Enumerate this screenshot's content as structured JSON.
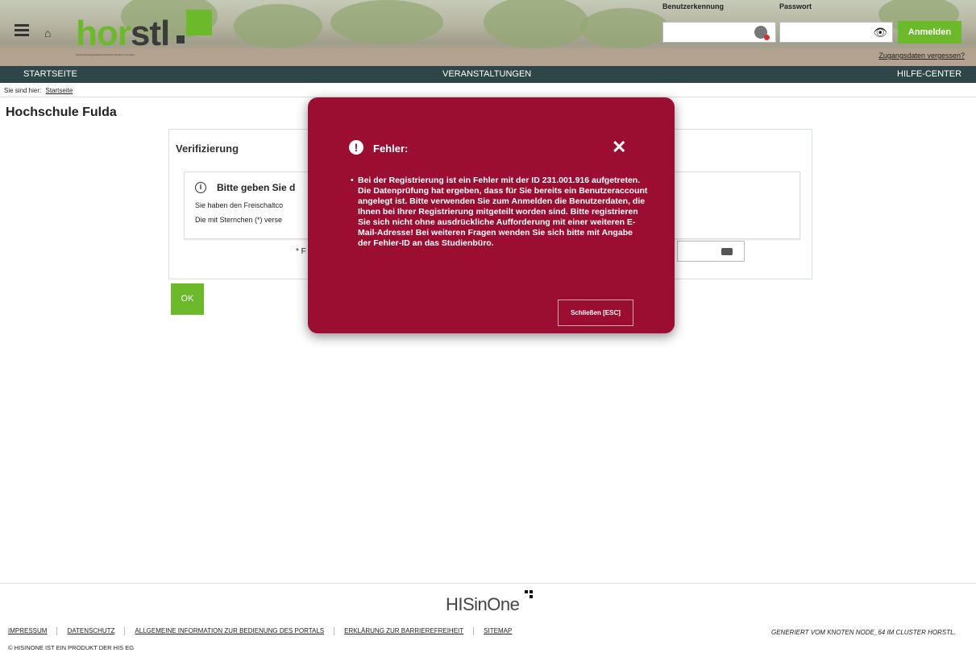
{
  "header": {
    "logo_text_green": "hor",
    "logo_text_dark": "stl",
    "logo_subtitle": "Hochschul-Organisations-Portal für Studium und Lehre",
    "username_label": "Benutzerkennung",
    "password_label": "Passwort",
    "username_value": "",
    "password_value": "",
    "login_button": "Anmelden",
    "forgot_link": "Zugangsdaten vergessen?"
  },
  "nav": {
    "items": [
      "STARTSEITE",
      "VERANSTALTUNGEN",
      "HILFE-CENTER"
    ]
  },
  "breadcrumb": {
    "prefix": "Sie sind hier:",
    "current": "Startseite"
  },
  "page": {
    "title": "Hochschule Fulda"
  },
  "verify": {
    "title": "Verifizierung",
    "info_title": "Bitte geben Sie d",
    "info_line1": "Sie haben den Freischaltco",
    "info_line2": "Die mit Sternchen (*) verse",
    "field_label": "* F",
    "ok_button": "OK"
  },
  "modal": {
    "title": "Fehler:",
    "close_symbol": "✕",
    "message": "Bei der Registrierung ist ein Fehler mit der ID 231.001.916 aufgetreten. Die Datenprüfung hat ergeben, dass für Sie bereits ein Benutzeraccount angelegt ist. Bitte verwenden Sie zum Anmelden die Benutzerdaten, die Ihnen bei Ihrer Registrierung mitgeteilt worden sind. Bitte registrieren Sie sich nicht ohne ausdrückliche Aufforderung mit einer weiteren E-Mail-Adresse! Bei weiteren Fragen wenden Sie sich bitte mit Angabe der Fehler-ID an das Studienbüro.",
    "close_button": "Schließen [ESC]"
  },
  "footer": {
    "brand": "HISinOne",
    "links": [
      "IMPRESSUM",
      "DATENSCHUTZ",
      "ALLGEMEINE INFORMATION ZUR BEDIENUNG DES PORTALS",
      "ERKLÄRUNG ZUR BARRIEREFREIHEIT",
      "SITEMAP"
    ],
    "copyright": "© HISINONE IST EIN PRODUKT DER HIS EG",
    "node_info": "GENERIERT VOM KNOTEN NODE_64 IM CLUSTER HORSTL."
  },
  "colors": {
    "brand_green": "#6cba2b",
    "nav_bar": "#2e4648",
    "error_red": "#9b0e32"
  }
}
